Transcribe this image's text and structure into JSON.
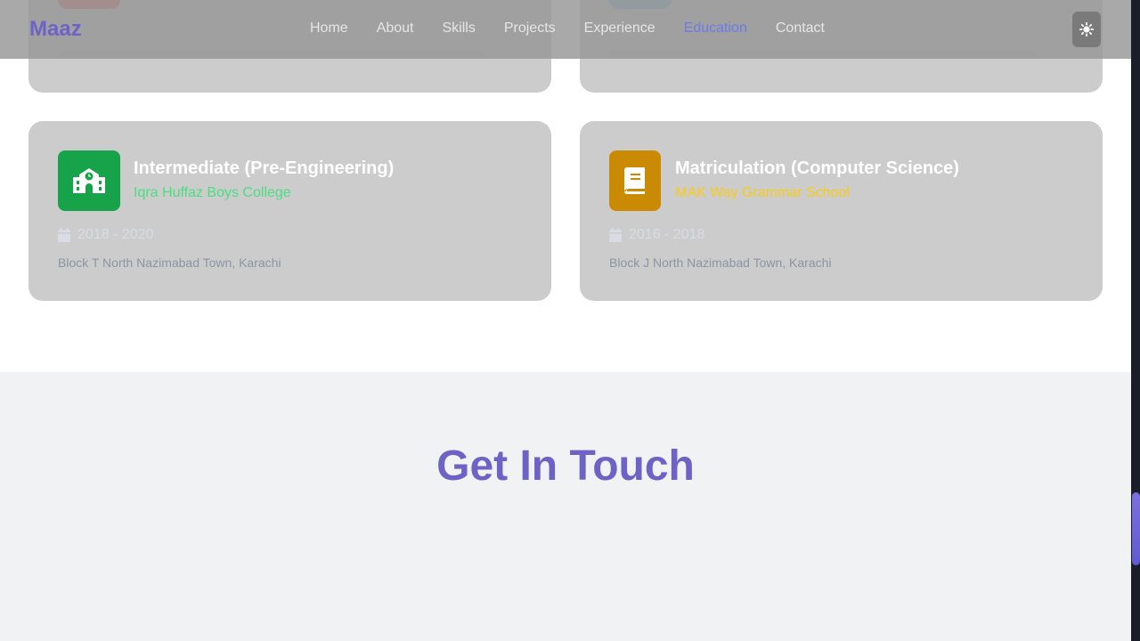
{
  "navbar": {
    "brand": "Maaz",
    "links": [
      {
        "label": "Home",
        "active": false
      },
      {
        "label": "About",
        "active": false
      },
      {
        "label": "Skills",
        "active": false
      },
      {
        "label": "Projects",
        "active": false
      },
      {
        "label": "Experience",
        "active": false
      },
      {
        "label": "Education",
        "active": true
      },
      {
        "label": "Contact",
        "active": false
      }
    ],
    "theme_toggle_icon": "sun-icon"
  },
  "education": {
    "cards": [
      {
        "icon": "school-icon",
        "icon_color": "#16a34a",
        "title": "Intermediate (Pre-Engineering)",
        "school": "Iqra Huffaz Boys College",
        "school_color": "#4ade80",
        "date": "2018 - 2020",
        "address": "Block T North Nazimabad Town, Karachi"
      },
      {
        "icon": "book-icon",
        "icon_color": "#ca8a04",
        "title": "Matriculation (Computer Science)",
        "school": "MAK Way Grammar School",
        "school_color": "#facc15",
        "date": "2016 - 2018",
        "address": "Block J North Nazimabad Town, Karachi"
      }
    ]
  },
  "contact": {
    "title": "Get In Touch"
  },
  "colors": {
    "brand": "#6d63c7",
    "nav_active": "#6b7be6",
    "card_bg": "#cccccc",
    "section_bg": "#f1f2f4"
  }
}
